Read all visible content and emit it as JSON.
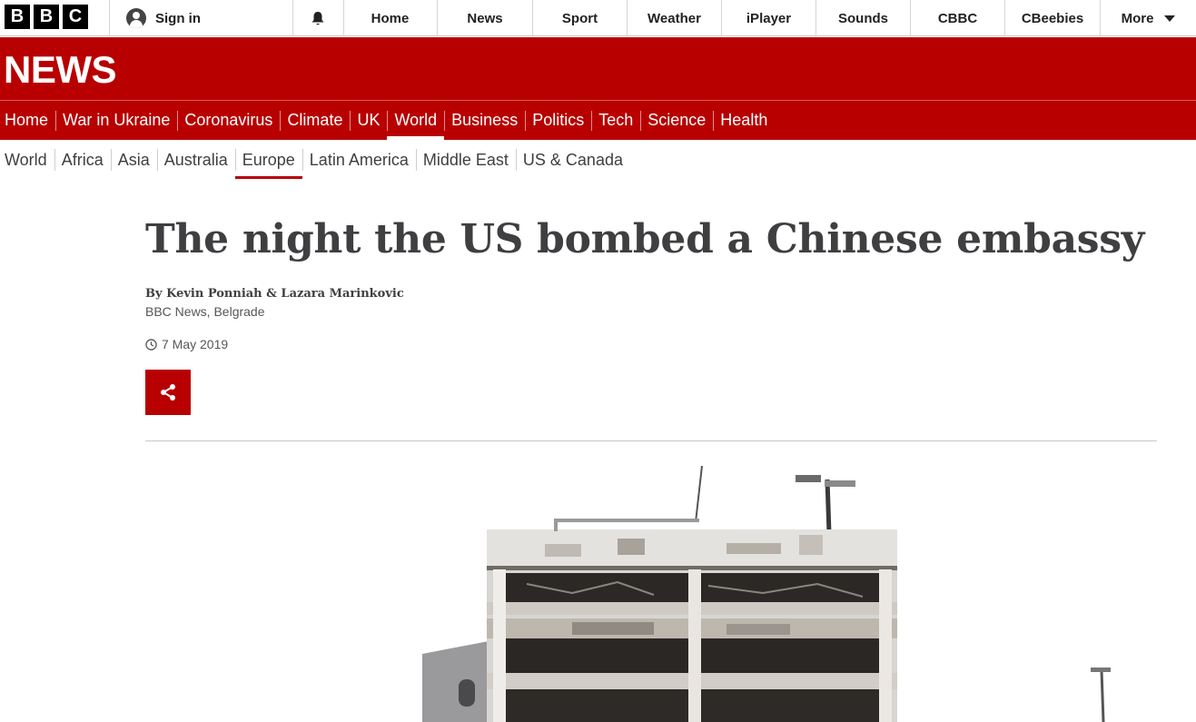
{
  "topbar": {
    "logo_letters": [
      "B",
      "B",
      "C"
    ],
    "signin_label": "Sign in",
    "nav": [
      "Home",
      "News",
      "Sport",
      "Weather",
      "iPlayer",
      "Sounds",
      "CBBC",
      "CBeebies"
    ],
    "more_label": "More"
  },
  "banner": {
    "title": "NEWS",
    "nav": [
      "Home",
      "War in Ukraine",
      "Coronavirus",
      "Climate",
      "UK",
      "World",
      "Business",
      "Politics",
      "Tech",
      "Science",
      "Health"
    ],
    "active": "World"
  },
  "subnav": {
    "items": [
      "World",
      "Africa",
      "Asia",
      "Australia",
      "Europe",
      "Latin America",
      "Middle East",
      "US & Canada"
    ],
    "active": "Europe"
  },
  "article": {
    "headline": "The night the US bombed a Chinese embassy",
    "byline": "By Kevin Ponniah & Lazara Marinkovic",
    "location": "BBC News, Belgrade",
    "date": "7 May 2019"
  },
  "colors": {
    "brand_red": "#b80000",
    "headline": "#3f3f42",
    "meta": "#545658"
  },
  "icons": [
    "user-icon",
    "bell-icon",
    "chevron-down-icon",
    "clock-icon",
    "share-icon"
  ]
}
